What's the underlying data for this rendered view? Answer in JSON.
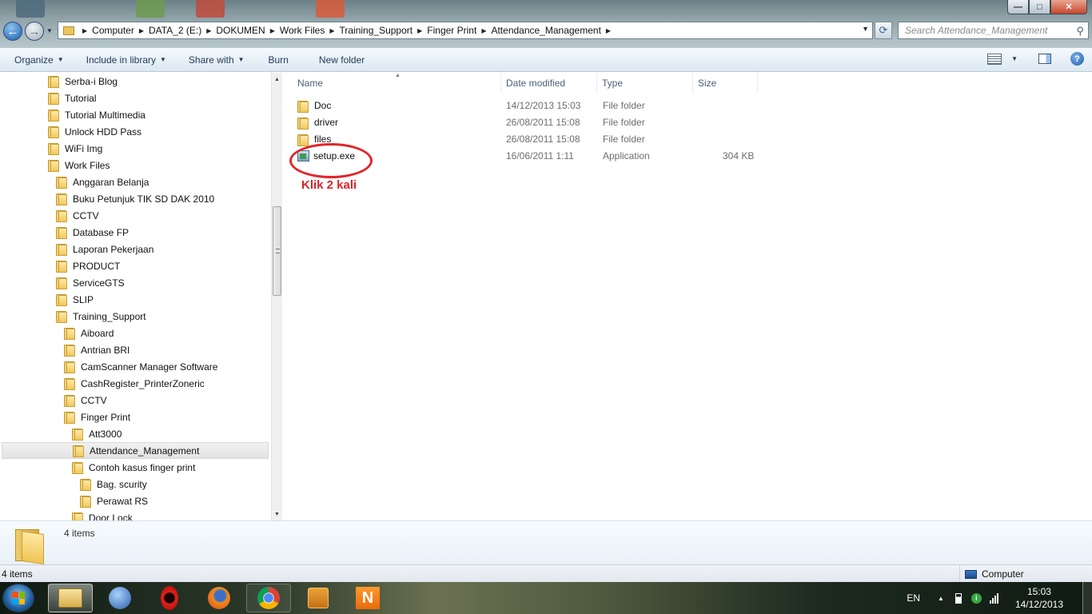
{
  "window": {
    "controls": {
      "minimize": "—",
      "maximize": "□",
      "close": "✕"
    }
  },
  "nav": {
    "back_icon": "back-arrow-icon",
    "forward_icon": "forward-arrow-icon"
  },
  "address": {
    "crumbs": [
      "Computer",
      "DATA_2 (E:)",
      "DOKUMEN",
      "Work Files",
      "Training_Support",
      "Finger Print",
      "Attendance_Management"
    ]
  },
  "search": {
    "placeholder": "Search Attendance_Management"
  },
  "toolbar": {
    "organize": "Organize",
    "include_in_library": "Include in library",
    "share_with": "Share with",
    "burn": "Burn",
    "new_folder": "New folder"
  },
  "tree": {
    "items": [
      {
        "label": "Serba-i Blog"
      },
      {
        "label": "Tutorial"
      },
      {
        "label": "Tutorial Multimedia"
      },
      {
        "label": "Unlock HDD Pass"
      },
      {
        "label": "WiFi Img"
      },
      {
        "label": "Work Files"
      },
      {
        "label": "Anggaran Belanja"
      },
      {
        "label": "Buku Petunjuk TIK SD DAK 2010"
      },
      {
        "label": "CCTV"
      },
      {
        "label": "Database FP"
      },
      {
        "label": "Laporan Pekerjaan"
      },
      {
        "label": "PRODUCT"
      },
      {
        "label": "ServiceGTS"
      },
      {
        "label": "SLIP"
      },
      {
        "label": "Training_Support"
      },
      {
        "label": "Aiboard"
      },
      {
        "label": "Antrian BRI"
      },
      {
        "label": "CamScanner Manager Software"
      },
      {
        "label": "CashRegister_PrinterZoneric"
      },
      {
        "label": "CCTV"
      },
      {
        "label": "Finger Print"
      },
      {
        "label": "Att3000"
      },
      {
        "label": "Attendance_Management",
        "selected": true
      },
      {
        "label": "Contoh kasus finger print"
      },
      {
        "label": "Bag. scurity"
      },
      {
        "label": "Perawat RS"
      },
      {
        "label": "Door Lock"
      }
    ]
  },
  "columns": {
    "name": "Name",
    "date_modified": "Date modified",
    "type": "Type",
    "size": "Size"
  },
  "files": [
    {
      "name": "Doc",
      "date": "14/12/2013 15:03",
      "type": "File folder",
      "size": "",
      "icon": "folder-icon"
    },
    {
      "name": "driver",
      "date": "26/08/2011 15:08",
      "type": "File folder",
      "size": "",
      "icon": "folder-icon"
    },
    {
      "name": "files",
      "date": "26/08/2011 15:08",
      "type": "File folder",
      "size": "",
      "icon": "folder-icon"
    },
    {
      "name": "setup.exe",
      "date": "16/06/2011 1:11",
      "type": "Application",
      "size": "304 KB",
      "icon": "application-icon"
    }
  ],
  "annotation": {
    "text": "Klik 2 kali",
    "color": "#d9262b"
  },
  "details": {
    "count": "4 items"
  },
  "status": {
    "left": "4 items",
    "right": "Computer"
  },
  "taskbar": {
    "apps": [
      "windows-explorer",
      "thunderbird",
      "opera",
      "firefox",
      "chrome",
      "media-player",
      "nero"
    ],
    "language": "EN",
    "time": "15:03",
    "date": "14/12/2013"
  }
}
